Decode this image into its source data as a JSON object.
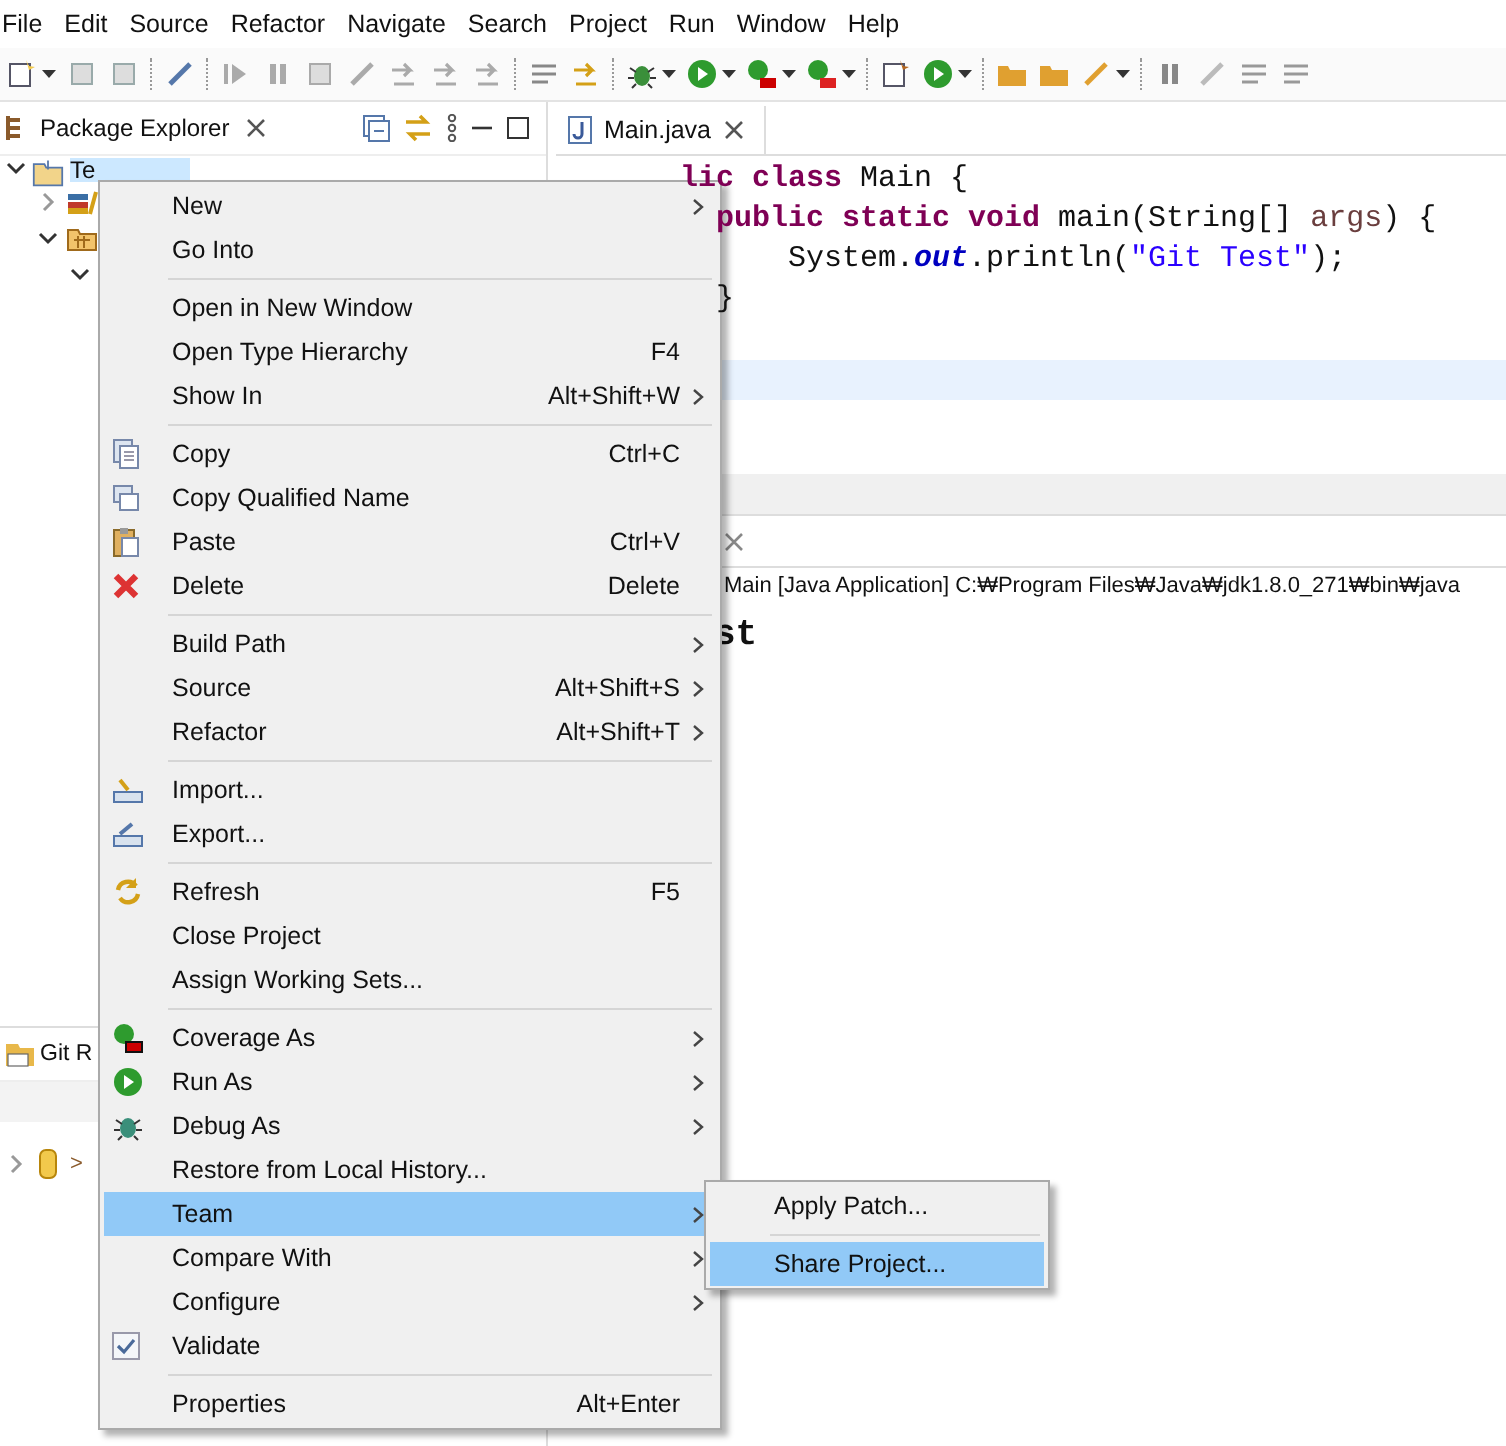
{
  "menu_bar": [
    "File",
    "Edit",
    "Source",
    "Refactor",
    "Navigate",
    "Search",
    "Project",
    "Run",
    "Window",
    "Help"
  ],
  "package_explorer": {
    "title": "Package Explorer",
    "tree": [
      {
        "label": "Te",
        "expanded": true,
        "selected": true,
        "children": [
          {
            "kind": "library",
            "expanded": false
          },
          {
            "kind": "source-folder",
            "expanded": true,
            "children": [
              {
                "expanded": true
              }
            ]
          }
        ]
      }
    ]
  },
  "git_repositories": {
    "title": "Git R",
    "rows": [
      {
        "expanded": false,
        "marker": ">"
      }
    ]
  },
  "editor": {
    "tab": "Main.java",
    "lines": [
      {
        "current": false,
        "tokens": [
          {
            "text": "lic class",
            "kind": "keyword"
          },
          {
            "text": " Main {",
            "kind": "plain"
          }
        ]
      },
      {
        "current": false,
        "tokens": [
          {
            "text": "  public static void",
            "kind": "keyword"
          },
          {
            "text": " main(String[] ",
            "kind": "plain"
          },
          {
            "text": "args",
            "kind": "param"
          },
          {
            "text": ") {",
            "kind": "plain"
          }
        ]
      },
      {
        "current": false,
        "tokens": [
          {
            "text": "      System.",
            "kind": "plain"
          },
          {
            "text": "out",
            "kind": "field"
          },
          {
            "text": ".println(",
            "kind": "plain"
          },
          {
            "text": "\"Git Test\"",
            "kind": "string"
          },
          {
            "text": ");",
            "kind": "plain"
          }
        ]
      },
      {
        "current": false,
        "tokens": [
          {
            "text": "  }",
            "kind": "plain"
          }
        ]
      },
      {
        "current": false
      },
      {
        "current": true
      }
    ]
  },
  "console": {
    "header": "Main [Java Application] C:₩Program Files₩Java₩jdk1.8.0_271₩bin₩java",
    "output": "st"
  },
  "context_menu": {
    "groups": [
      [
        {
          "label": "New",
          "submenu": true,
          "selected": false
        },
        {
          "label": "Go Into",
          "submenu": false,
          "selected": false
        }
      ],
      [
        {
          "label": "Open in New Window",
          "submenu": false,
          "selected": false
        },
        {
          "label": "Open Type Hierarchy",
          "shortcut": "F4",
          "submenu": false,
          "selected": false
        },
        {
          "label": "Show In",
          "shortcut": "Alt+Shift+W",
          "submenu": true,
          "selected": false
        }
      ],
      [
        {
          "label": "Copy",
          "kind": "copy",
          "shortcut": "Ctrl+C",
          "submenu": false,
          "selected": false
        },
        {
          "label": "Copy Qualified Name",
          "kind": "copy-name",
          "submenu": false,
          "selected": false
        },
        {
          "label": "Paste",
          "kind": "paste",
          "shortcut": "Ctrl+V",
          "submenu": false,
          "selected": false
        },
        {
          "label": "Delete",
          "kind": "delete",
          "shortcut": "Delete",
          "submenu": false,
          "selected": false
        }
      ],
      [
        {
          "label": "Build Path",
          "submenu": true,
          "selected": false
        },
        {
          "label": "Source",
          "shortcut": "Alt+Shift+S",
          "submenu": true,
          "selected": false
        },
        {
          "label": "Refactor",
          "shortcut": "Alt+Shift+T",
          "submenu": true,
          "selected": false
        }
      ],
      [
        {
          "label": "Import...",
          "kind": "import",
          "submenu": false,
          "selected": false
        },
        {
          "label": "Export...",
          "kind": "export",
          "submenu": false,
          "selected": false
        }
      ],
      [
        {
          "label": "Refresh",
          "kind": "refresh",
          "shortcut": "F5",
          "submenu": false,
          "selected": false
        },
        {
          "label": "Close Project",
          "submenu": false,
          "selected": false
        },
        {
          "label": "Assign Working Sets...",
          "submenu": false,
          "selected": false
        }
      ],
      [
        {
          "label": "Coverage As",
          "kind": "coverage",
          "submenu": true,
          "selected": false
        },
        {
          "label": "Run As",
          "kind": "run",
          "submenu": true,
          "selected": false
        },
        {
          "label": "Debug As",
          "kind": "debug",
          "submenu": true,
          "selected": false
        },
        {
          "label": "Restore from Local History...",
          "submenu": false,
          "selected": false
        },
        {
          "label": "Team",
          "submenu": true,
          "selected": true
        },
        {
          "label": "Compare With",
          "submenu": true,
          "selected": false
        },
        {
          "label": "Configure",
          "submenu": true,
          "selected": false
        },
        {
          "label": "Validate",
          "kind": "check",
          "checked": true,
          "submenu": false,
          "selected": false
        }
      ],
      [
        {
          "label": "Properties",
          "shortcut": "Alt+Enter",
          "submenu": false,
          "selected": false
        }
      ]
    ]
  },
  "team_submenu": {
    "groups": [
      [
        {
          "label": "Apply Patch...",
          "selected": false
        }
      ],
      [
        {
          "label": "Share Project...",
          "selected": true
        }
      ]
    ]
  }
}
